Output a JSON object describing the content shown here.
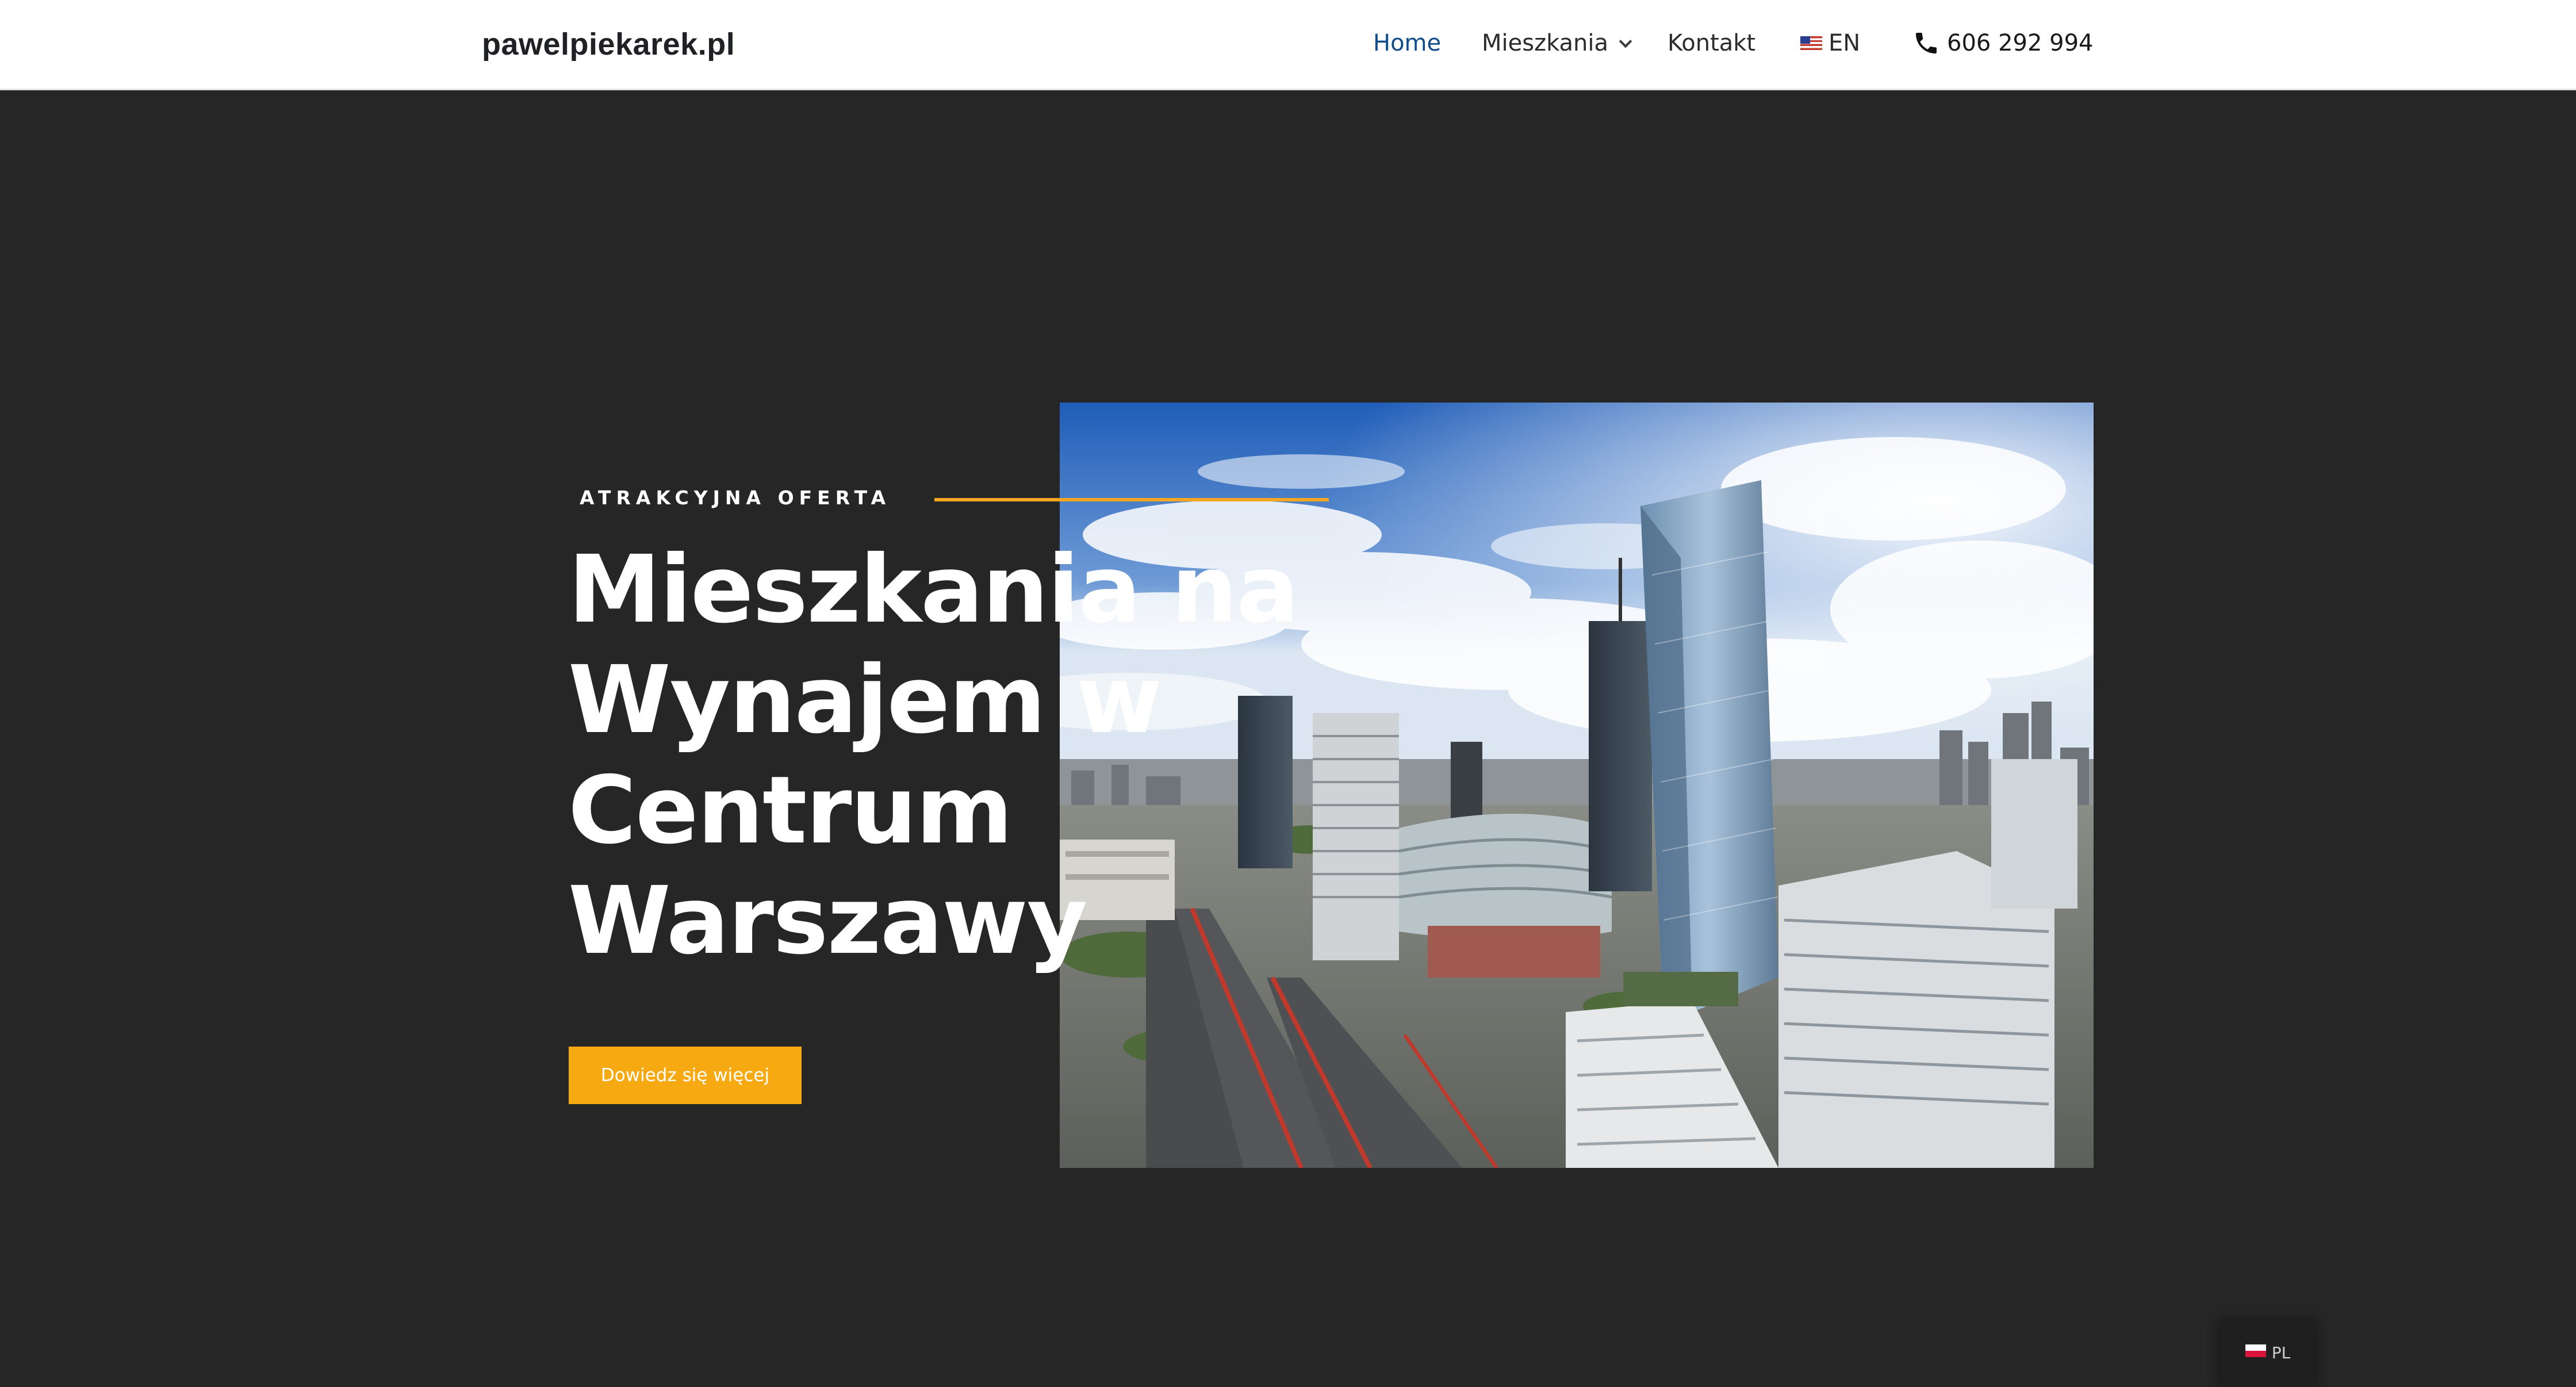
{
  "header": {
    "logo": "pawelpiekarek.pl",
    "nav": {
      "home": "Home",
      "apartments": "Mieszkania",
      "contact": "Kontakt",
      "language": "EN",
      "phone": "606 292 994"
    }
  },
  "hero": {
    "eyebrow": "ATRAKCYJNA OFERTA",
    "title_lines": [
      "Mieszkania na",
      "Wynajem w",
      "Centrum",
      "Warszawy"
    ],
    "cta_label": "Dowiedz się więcej"
  },
  "language_switcher": {
    "label": "PL"
  },
  "colors": {
    "background": "#262626",
    "accent": "#f7a911",
    "nav_active": "#0f4d8a"
  },
  "icons": {
    "phone": "phone-icon",
    "chevron": "chevron-down-icon",
    "flag_en": "flag-us-icon",
    "flag_pl": "flag-pl-icon"
  }
}
